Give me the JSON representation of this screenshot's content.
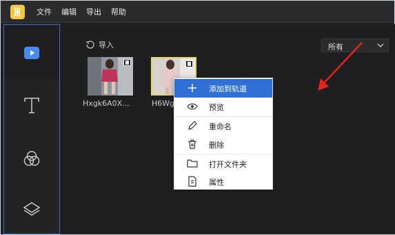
{
  "menu": [
    "文件",
    "编辑",
    "导出",
    "帮助"
  ],
  "toolbar": {
    "import_label": "导入"
  },
  "filter": {
    "value": "所有"
  },
  "media": [
    {
      "name": "Hxgk6A0X..."
    },
    {
      "name": "H6Wg"
    }
  ],
  "context_menu": {
    "items": [
      {
        "label": "添加到轨道",
        "icon": "plus-icon",
        "highlighted": true
      },
      {
        "label": "预览",
        "icon": "eye-icon"
      },
      {
        "label": "重命名",
        "icon": "pencil-icon"
      },
      {
        "label": "删除",
        "icon": "trash-icon"
      },
      {
        "label": "打开文件夹",
        "icon": "folder-icon"
      },
      {
        "label": "属性",
        "icon": "properties-icon"
      }
    ]
  },
  "colors": {
    "accent": "#2f6fd6",
    "background": "#1f1f21",
    "selection_border": "#e6d86b",
    "annotation_arrow": "#e3241b",
    "logo": "#f6c640"
  }
}
